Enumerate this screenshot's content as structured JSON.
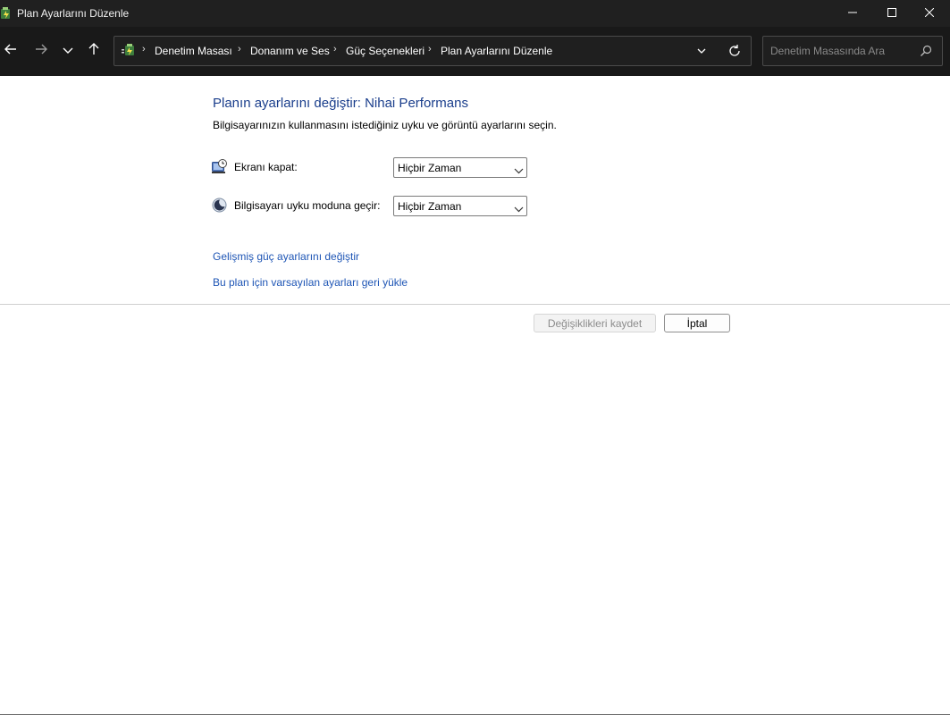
{
  "window": {
    "title": "Plan Ayarlarını Düzenle",
    "icon": "power-options-icon"
  },
  "controls": {
    "minimize": "minimize-icon",
    "maximize": "maximize-icon",
    "close": "close-icon"
  },
  "nav": {
    "back": "back-arrow-icon",
    "forward": "forward-arrow-icon",
    "recent": "chevron-down-icon",
    "up": "up-arrow-icon"
  },
  "address": {
    "icon": "control-panel-icon",
    "breadcrumbs": [
      {
        "label": "Denetim Masası"
      },
      {
        "label": "Donanım ve Ses"
      },
      {
        "label": "Güç Seçenekleri"
      },
      {
        "label": "Plan Ayarlarını Düzenle"
      }
    ]
  },
  "search": {
    "value": "",
    "placeholder": "Denetim Masasında Ara"
  },
  "main": {
    "title": "Planın ayarlarını değiştir: Nihai Performans",
    "description": "Bilgisayarınızın kullanmasını istediğiniz uyku ve görüntü ayarlarını seçin.",
    "settings": [
      {
        "label": "Ekranı kapat:",
        "value": "Hiçbir Zaman",
        "icon": "display-clock-icon"
      },
      {
        "label": "Bilgisayarı uyku moduna geçir:",
        "value": "Hiçbir Zaman",
        "icon": "moon-sleep-icon"
      }
    ],
    "links": {
      "advanced": "Gelişmiş güç ayarlarını değiştir",
      "restore": "Bu plan için varsayılan ayarları geri yükle"
    },
    "buttons": {
      "save": "Değişiklikleri kaydet",
      "cancel": "İptal"
    }
  },
  "colors": {
    "titlebar_bg": "#202020",
    "navbar_bg": "#191919",
    "heading": "#1a3e8c",
    "link": "#1e55b5"
  }
}
